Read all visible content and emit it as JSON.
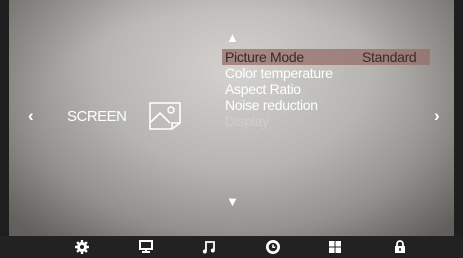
{
  "nav": {
    "left_arrow": "‹",
    "right_arrow": "›",
    "up_arrow": "▲",
    "down_arrow": "▼"
  },
  "category": {
    "label": "SCREEN",
    "icon": "picture-icon"
  },
  "menu": {
    "items": [
      {
        "label": "Picture Mode",
        "value": "Standard",
        "state": "selected"
      },
      {
        "label": "Color temperature",
        "value": "",
        "state": "normal"
      },
      {
        "label": "Aspect Ratio",
        "value": "",
        "state": "normal"
      },
      {
        "label": "Noise reduction",
        "value": "",
        "state": "normal"
      },
      {
        "label": "Display",
        "value": "",
        "state": "disabled"
      }
    ]
  },
  "bottom_tabs": [
    {
      "icon": "gear-icon"
    },
    {
      "icon": "monitor-icon"
    },
    {
      "icon": "music-icon"
    },
    {
      "icon": "clock-icon",
      "active": true
    },
    {
      "icon": "grid-icon"
    },
    {
      "icon": "lock-icon"
    }
  ],
  "colors": {
    "selected_highlight": "#966e69",
    "bar": "#222222",
    "text": "#ffffff",
    "disabled_text": "#cfcecc"
  }
}
